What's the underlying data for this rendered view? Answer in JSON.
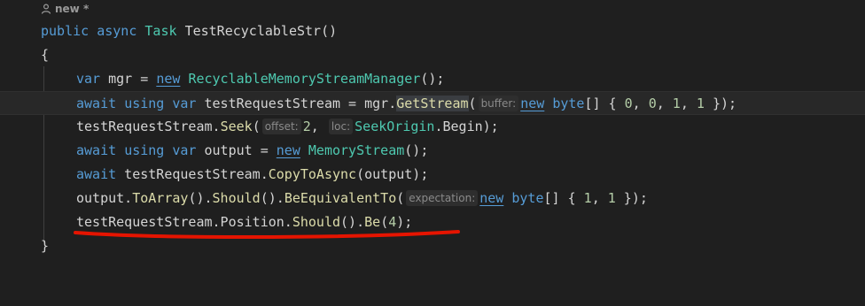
{
  "codelens": {
    "label": "new *"
  },
  "code": {
    "signature": {
      "kw1": "public",
      "kw2": "async",
      "type": "Task",
      "name": "TestRecyclableStr()"
    },
    "open_brace": "{",
    "close_brace": "}",
    "line1": {
      "kw": "var",
      "a": " mgr = ",
      "new": "new",
      "sp": " ",
      "type": "RecyclableMemoryStreamManager",
      "b": "();"
    },
    "line2": {
      "kw1": "await",
      "kw2": "using",
      "kw3": "var",
      "a": " testRequestStream = mgr.",
      "method": "GetStream",
      "b": "(",
      "hint": "buffer:",
      "new": "new",
      "c": " ",
      "kw4": "byte",
      "d": "[] { ",
      "n1": "0",
      "e": ", ",
      "n2": "0",
      "f": ", ",
      "n3": "1",
      "g": ", ",
      "n4": "1",
      "h": " });"
    },
    "line3": {
      "a": "testRequestStream.",
      "method": "Seek",
      "b": "(",
      "hint1": "offset:",
      "n1": "2",
      "c": ", ",
      "hint2": "loc:",
      "type": "SeekOrigin",
      "d": ".Begin);"
    },
    "line4": {
      "kw1": "await",
      "kw2": "using",
      "kw3": "var",
      "a": " output = ",
      "new": "new",
      "sp": " ",
      "type": "MemoryStream",
      "b": "();"
    },
    "line5": {
      "kw": "await",
      "a": " testRequestStream.",
      "method": "CopyToAsync",
      "b": "(output);"
    },
    "line6": {
      "a": "output.",
      "m1": "ToArray",
      "b": "().",
      "m2": "Should",
      "c": "().",
      "m3": "BeEquivalentTo",
      "d": "(",
      "hint": "expectation:",
      "new": "new",
      "e": " ",
      "kw": "byte",
      "f": "[] { ",
      "n1": "1",
      "g": ", ",
      "n2": "1",
      "h": " });"
    },
    "line7": {
      "a": "testRequestStream.Position.",
      "m1": "Should",
      "b": "().",
      "m2": "Be",
      "c": "(",
      "n1": "4",
      "d": ");"
    }
  },
  "colors": {
    "background": "#1f1f1f",
    "keyword": "#569cd6",
    "type": "#4ec9b0",
    "method": "#dcdcaa",
    "number": "#b5cea8",
    "squiggle": "#e51400"
  }
}
